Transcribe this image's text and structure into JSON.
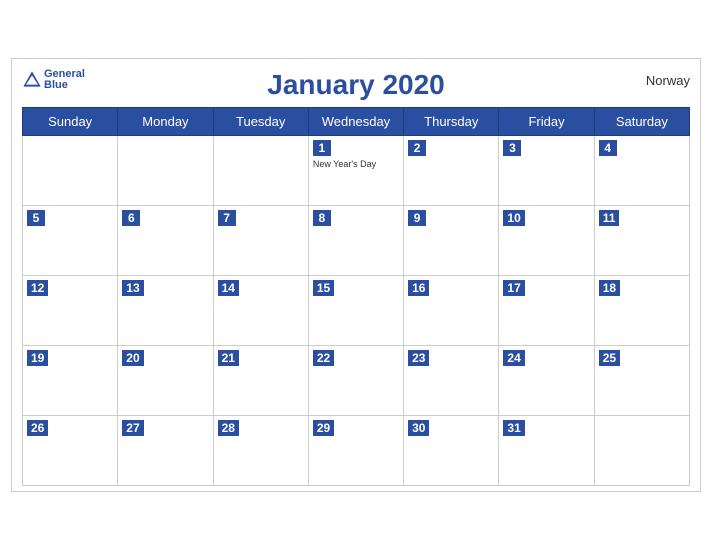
{
  "header": {
    "title": "January 2020",
    "country": "Norway",
    "logo": {
      "general": "General",
      "blue": "Blue"
    }
  },
  "weekdays": [
    "Sunday",
    "Monday",
    "Tuesday",
    "Wednesday",
    "Thursday",
    "Friday",
    "Saturday"
  ],
  "weeks": [
    [
      {
        "day": "",
        "empty": true
      },
      {
        "day": "",
        "empty": true
      },
      {
        "day": "",
        "empty": true
      },
      {
        "day": "1",
        "holiday": "New Year's Day"
      },
      {
        "day": "2"
      },
      {
        "day": "3"
      },
      {
        "day": "4"
      }
    ],
    [
      {
        "day": "5"
      },
      {
        "day": "6"
      },
      {
        "day": "7"
      },
      {
        "day": "8"
      },
      {
        "day": "9"
      },
      {
        "day": "10"
      },
      {
        "day": "11"
      }
    ],
    [
      {
        "day": "12"
      },
      {
        "day": "13"
      },
      {
        "day": "14"
      },
      {
        "day": "15"
      },
      {
        "day": "16"
      },
      {
        "day": "17"
      },
      {
        "day": "18"
      }
    ],
    [
      {
        "day": "19"
      },
      {
        "day": "20"
      },
      {
        "day": "21"
      },
      {
        "day": "22"
      },
      {
        "day": "23"
      },
      {
        "day": "24"
      },
      {
        "day": "25"
      }
    ],
    [
      {
        "day": "26"
      },
      {
        "day": "27"
      },
      {
        "day": "28"
      },
      {
        "day": "29"
      },
      {
        "day": "30"
      },
      {
        "day": "31"
      },
      {
        "day": "",
        "empty": true
      }
    ]
  ]
}
